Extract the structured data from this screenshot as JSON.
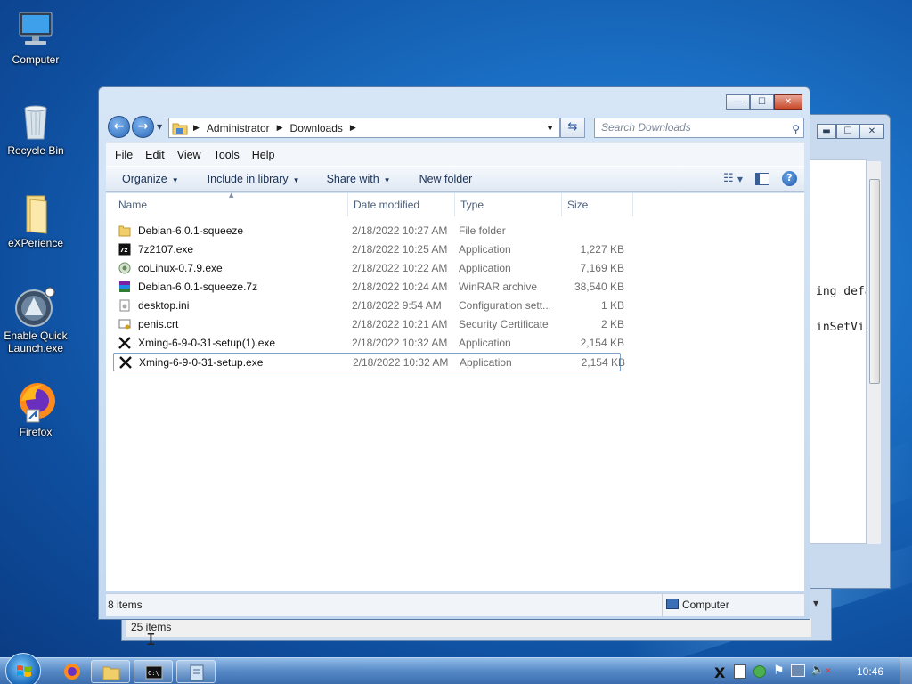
{
  "desktop": {
    "icons": [
      {
        "label": "Computer"
      },
      {
        "label": "Recycle Bin"
      },
      {
        "label": "eXPerience"
      },
      {
        "label": "Enable Quick Launch.exe"
      },
      {
        "label": "Firefox"
      }
    ]
  },
  "background_window": {
    "text_line_1": "ing defa",
    "text_line_2": "inSetVis",
    "status_text": "25 items"
  },
  "explorer": {
    "title_buttons": {
      "minimize": "—",
      "maximize": "☐",
      "close": "✕"
    },
    "breadcrumb": [
      "Administrator",
      "Downloads"
    ],
    "search_placeholder": "Search Downloads",
    "menu": [
      "File",
      "Edit",
      "View",
      "Tools",
      "Help"
    ],
    "toolbar": {
      "organize": "Organize",
      "include_in_library": "Include in library",
      "share_with": "Share with",
      "new_folder": "New folder"
    },
    "columns": {
      "name": "Name",
      "date": "Date modified",
      "type": "Type",
      "size": "Size"
    },
    "files": [
      {
        "name": "Debian-6.0.1-squeeze",
        "date": "2/18/2022 10:27 AM",
        "type": "File folder",
        "size": "",
        "icon": "folder-icon"
      },
      {
        "name": "7z2107.exe",
        "date": "2/18/2022 10:25 AM",
        "type": "Application",
        "size": "1,227 KB",
        "icon": "7zip-icon"
      },
      {
        "name": "coLinux-0.7.9.exe",
        "date": "2/18/2022 10:22 AM",
        "type": "Application",
        "size": "7,169 KB",
        "icon": "colinux-icon"
      },
      {
        "name": "Debian-6.0.1-squeeze.7z",
        "date": "2/18/2022 10:24 AM",
        "type": "WinRAR archive",
        "size": "38,540 KB",
        "icon": "winrar-icon"
      },
      {
        "name": "desktop.ini",
        "date": "2/18/2022 9:54 AM",
        "type": "Configuration sett...",
        "size": "1 KB",
        "icon": "ini-file-icon"
      },
      {
        "name": "penis.crt",
        "date": "2/18/2022 10:21 AM",
        "type": "Security Certificate",
        "size": "2 KB",
        "icon": "certificate-icon"
      },
      {
        "name": "Xming-6-9-0-31-setup(1).exe",
        "date": "2/18/2022 10:32 AM",
        "type": "Application",
        "size": "2,154 KB",
        "icon": "xming-icon"
      },
      {
        "name": "Xming-6-9-0-31-setup.exe",
        "date": "2/18/2022 10:32 AM",
        "type": "Application",
        "size": "2,154 KB",
        "icon": "xming-icon"
      }
    ],
    "selected_index": 7,
    "status": {
      "count": "8 items",
      "zone": "Computer"
    }
  },
  "taskbar": {
    "clock": "10:46"
  },
  "colors": {
    "accent": "#2a68b8",
    "selection_border": "#7da2ce",
    "close_red": "#c94a2c"
  }
}
